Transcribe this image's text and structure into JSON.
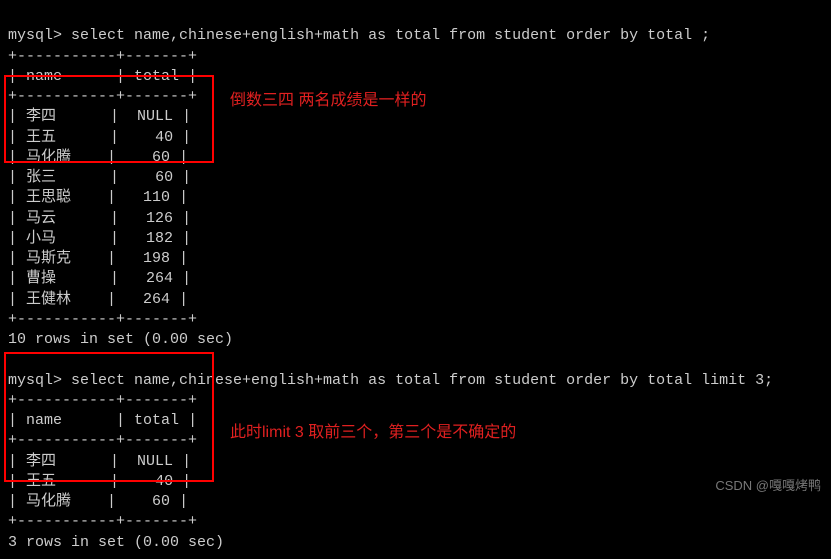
{
  "query1": {
    "prompt": "mysql>",
    "sql": " select name,chinese+english+math as total from student order by total ;",
    "separator_top": "+-----------+-------+",
    "header_name": "name",
    "header_total": "total",
    "separator_mid": "+-----------+-------+",
    "rows": [
      {
        "name": "李四",
        "total": "NULL"
      },
      {
        "name": "王五",
        "total": "40"
      },
      {
        "name": "马化腾",
        "total": "60"
      },
      {
        "name": "张三",
        "total": "60"
      },
      {
        "name": "王思聪",
        "total": "110"
      },
      {
        "name": "马云",
        "total": "126"
      },
      {
        "name": "小马",
        "total": "182"
      },
      {
        "name": "马斯克",
        "total": "198"
      },
      {
        "name": "曹操",
        "total": "264"
      },
      {
        "name": "王健林",
        "total": "264"
      }
    ],
    "separator_bot": "+-----------+-------+",
    "footer": "10 rows in set (0.00 sec)"
  },
  "query2": {
    "prompt": "mysql>",
    "sql": " select name,chinese+english+math as total from student order by total limit 3;",
    "separator_top": "+-----------+-------+",
    "header_name": "name",
    "header_total": "total",
    "separator_mid": "+-----------+-------+",
    "rows": [
      {
        "name": "李四",
        "total": "NULL"
      },
      {
        "name": "王五",
        "total": "40"
      },
      {
        "name": "马化腾",
        "total": "60"
      }
    ],
    "separator_bot": "+-----------+-------+",
    "footer": "3 rows in set (0.00 sec)"
  },
  "annotations": {
    "anno1": "倒数三四 两名成绩是一样的",
    "anno2": "此时limit 3 取前三个，第三个是不确定的"
  },
  "watermark": "CSDN @嘎嘎烤鸭"
}
